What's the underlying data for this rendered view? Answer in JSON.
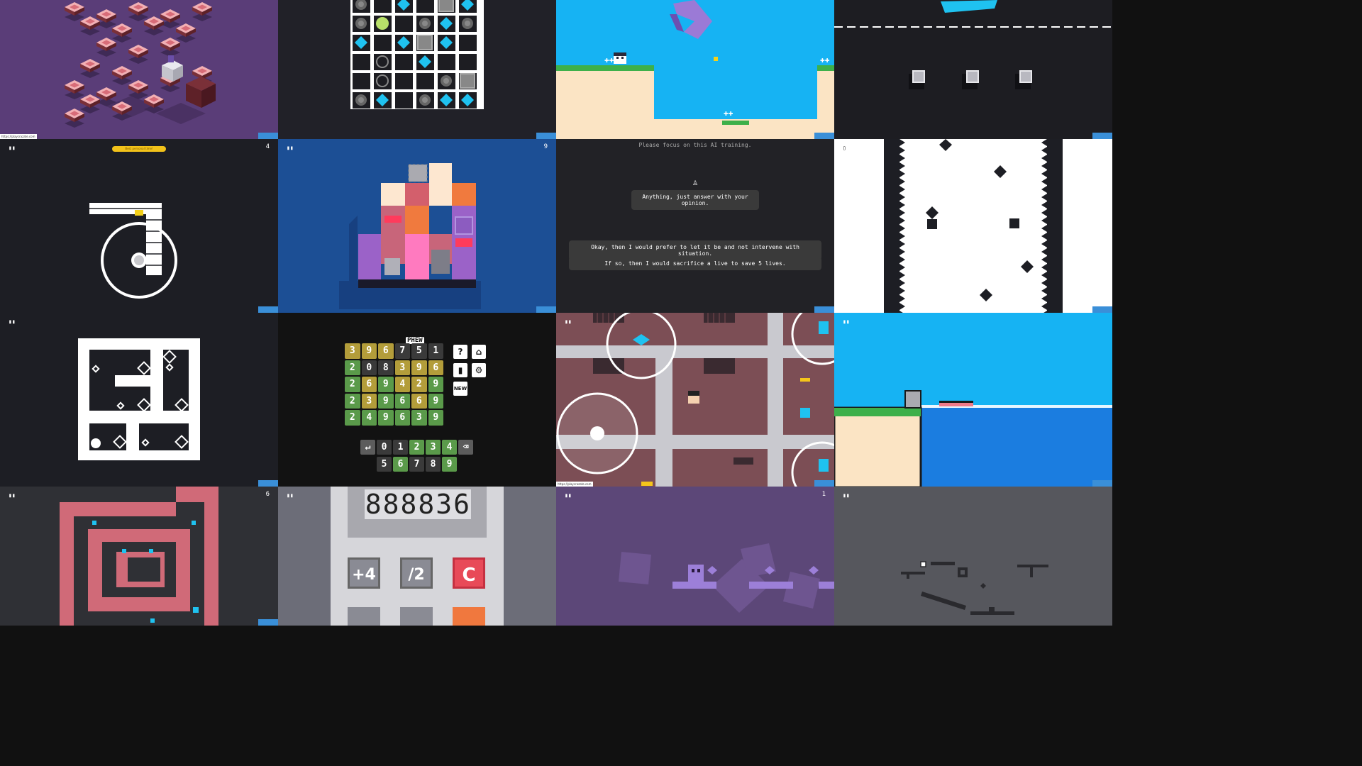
{
  "tiles": [
    {
      "id": "iso-cubes",
      "bg": "#5a3d78"
    },
    {
      "id": "gem-grid",
      "bg": "#212128"
    },
    {
      "id": "water-platformer",
      "bg": "#16b3f3"
    },
    {
      "id": "dash-line",
      "bg": "#1d1d22"
    },
    {
      "id": "brick-circle",
      "bg": "#1d1e24"
    },
    {
      "id": "voxel-tower",
      "bg": "#1c4f95"
    },
    {
      "id": "ai-dialogue",
      "bg": "#222226"
    },
    {
      "id": "spike-wall",
      "bg": "#ffffff"
    },
    {
      "id": "maze-diamonds",
      "bg": "#1d1e24"
    },
    {
      "id": "number-puzzle",
      "bg": "#121212"
    },
    {
      "id": "topdown-city",
      "bg": "#7c4e55"
    },
    {
      "id": "sea-platform",
      "bg": "#16b3f3"
    },
    {
      "id": "pink-maze",
      "bg": "#2f3035"
    },
    {
      "id": "calculator",
      "bg": "#6c6d78"
    },
    {
      "id": "purple-cubes",
      "bg": "#5c4778"
    },
    {
      "id": "gray-bars",
      "bg": "#56575d"
    }
  ],
  "brick_circle": {
    "banner": "Best personal time!",
    "counter": "4"
  },
  "voxel_tower": {
    "counter": "9"
  },
  "ai_dialogue": {
    "header": "Please focus on this AI training.",
    "question": "Anything, just answer with your opinion.",
    "option_a": "Okay, then I would prefer to let it be and not intervene with situation.",
    "option_b": "If so, then I would sacrifice a live to save 5 lives."
  },
  "pink_maze": {
    "counter": "6"
  },
  "purple_cubes": {
    "counter": "1"
  },
  "number_puzzle": {
    "bubble": "PHEW",
    "rows": [
      [
        {
          "d": "3",
          "c": "y"
        },
        {
          "d": "9",
          "c": "y"
        },
        {
          "d": "6",
          "c": "y"
        },
        {
          "d": "7",
          "c": "n"
        },
        {
          "d": "5",
          "c": "n"
        },
        {
          "d": "1",
          "c": "n"
        }
      ],
      [
        {
          "d": "2",
          "c": "g"
        },
        {
          "d": "0",
          "c": "n"
        },
        {
          "d": "8",
          "c": "n"
        },
        {
          "d": "3",
          "c": "y"
        },
        {
          "d": "9",
          "c": "y"
        },
        {
          "d": "6",
          "c": "y"
        }
      ],
      [
        {
          "d": "2",
          "c": "g"
        },
        {
          "d": "6",
          "c": "y"
        },
        {
          "d": "9",
          "c": "g"
        },
        {
          "d": "4",
          "c": "y"
        },
        {
          "d": "2",
          "c": "y"
        },
        {
          "d": "9",
          "c": "g"
        }
      ],
      [
        {
          "d": "2",
          "c": "g"
        },
        {
          "d": "3",
          "c": "y"
        },
        {
          "d": "9",
          "c": "g"
        },
        {
          "d": "6",
          "c": "g"
        },
        {
          "d": "6",
          "c": "y"
        },
        {
          "d": "9",
          "c": "g"
        }
      ],
      [
        {
          "d": "2",
          "c": "g"
        },
        {
          "d": "4",
          "c": "g"
        },
        {
          "d": "9",
          "c": "g"
        },
        {
          "d": "6",
          "c": "g"
        },
        {
          "d": "3",
          "c": "g"
        },
        {
          "d": "9",
          "c": "g"
        }
      ]
    ],
    "keys_row1": [
      {
        "d": "↵",
        "c": "k"
      },
      {
        "d": "0",
        "c": "n"
      },
      {
        "d": "1",
        "c": "n"
      },
      {
        "d": "2",
        "c": "g"
      },
      {
        "d": "3",
        "c": "g"
      },
      {
        "d": "4",
        "c": "g"
      },
      {
        "d": "⌫",
        "c": "k"
      }
    ],
    "keys_row2": [
      {
        "d": "5",
        "c": "n"
      },
      {
        "d": "6",
        "c": "g"
      },
      {
        "d": "7",
        "c": "n"
      },
      {
        "d": "8",
        "c": "n"
      },
      {
        "d": "9",
        "c": "g"
      }
    ],
    "side_buttons": [
      "?",
      "⌂",
      "▮",
      "⚙",
      "NEW"
    ]
  },
  "calculator": {
    "display": "888836",
    "btn_add": "+4",
    "btn_div": "/2",
    "btn_clear": "C"
  },
  "colors": {
    "yellow": "#b39d3a",
    "green": "#5a9a4a",
    "gray": "#3a3a3a",
    "accent_cyan": "#1fc2f0"
  }
}
